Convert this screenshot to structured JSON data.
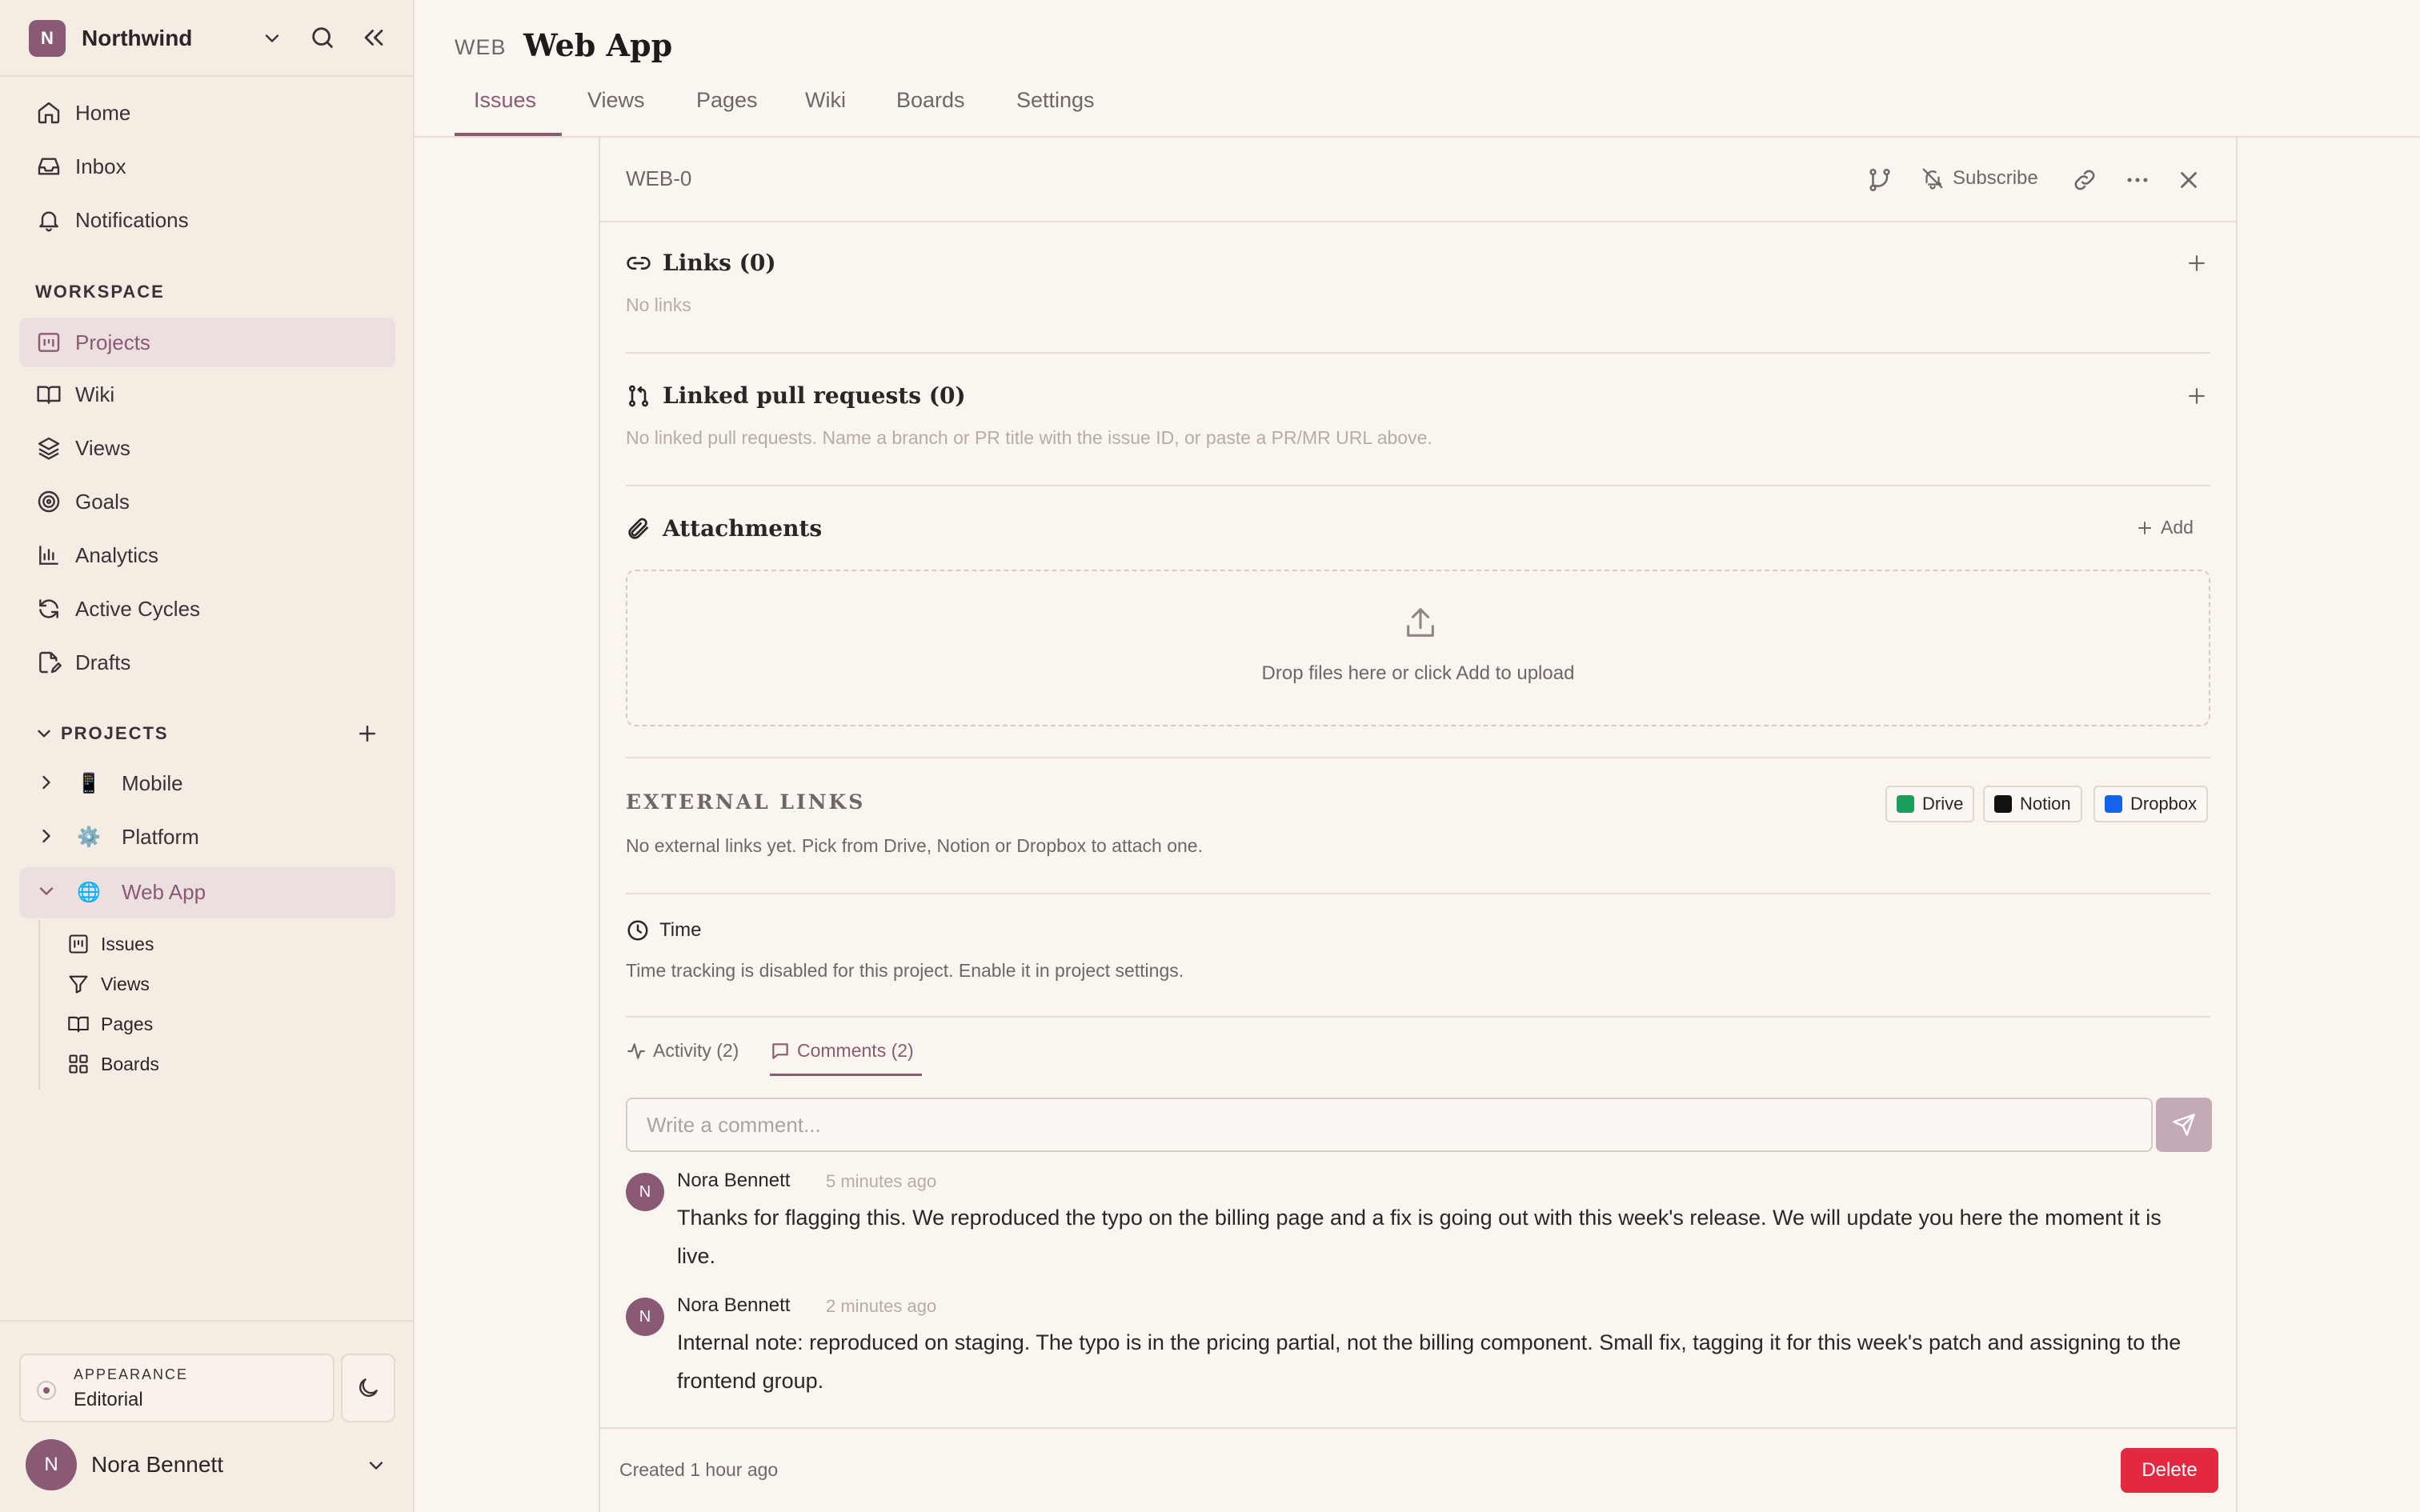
{
  "colors": {
    "accent": "#8a5a75",
    "background": "#faf6ef",
    "sidebar_bg": "#f4ede4",
    "active_bg": "#ebdfdf",
    "danger": "#e5283f"
  },
  "workspace": {
    "avatar_letter": "N",
    "name": "Northwind"
  },
  "nav": {
    "items": [
      {
        "label": "Home",
        "icon": "home-icon"
      },
      {
        "label": "Inbox",
        "icon": "inbox-icon"
      },
      {
        "label": "Notifications",
        "icon": "bell-icon"
      }
    ]
  },
  "workspace_section": {
    "title": "WORKSPACE",
    "items": [
      {
        "label": "Projects",
        "icon": "projects-icon",
        "active": true
      },
      {
        "label": "Wiki",
        "icon": "book-icon"
      },
      {
        "label": "Views",
        "icon": "layers-icon"
      },
      {
        "label": "Goals",
        "icon": "target-icon"
      },
      {
        "label": "Analytics",
        "icon": "bar-chart-icon"
      },
      {
        "label": "Active Cycles",
        "icon": "refresh-icon"
      },
      {
        "label": "Drafts",
        "icon": "draft-icon"
      }
    ]
  },
  "projects_section": {
    "title": "PROJECTS",
    "items": [
      {
        "label": "Mobile",
        "emoji": "📱",
        "expanded": false
      },
      {
        "label": "Platform",
        "emoji": "⚙️",
        "expanded": false
      },
      {
        "label": "Web App",
        "emoji": "🌐",
        "expanded": true,
        "active": true
      }
    ],
    "sub_items": [
      {
        "label": "Issues",
        "icon": "issues-icon"
      },
      {
        "label": "Views",
        "icon": "filter-icon"
      },
      {
        "label": "Pages",
        "icon": "book-icon"
      },
      {
        "label": "Boards",
        "icon": "grid-icon"
      }
    ]
  },
  "appearance": {
    "caption": "APPEARANCE",
    "value": "Editorial"
  },
  "user": {
    "avatar_letter": "N",
    "name": "Nora Bennett"
  },
  "header": {
    "project_key": "WEB",
    "project_title": "Web App",
    "tabs": [
      "Issues",
      "Views",
      "Pages",
      "Wiki",
      "Boards",
      "Settings"
    ],
    "active_tab": "Issues"
  },
  "issue": {
    "id": "WEB-0",
    "subscribe_label": "Subscribe",
    "links": {
      "title": "Links (0)",
      "empty": "No links"
    },
    "pull_requests": {
      "title": "Linked pull requests (0)",
      "empty": "No linked pull requests. Name a branch or PR title with the issue ID, or paste a PR/MR URL above."
    },
    "attachments": {
      "title": "Attachments",
      "add_label": "Add",
      "drop_text": "Drop files here or click Add to upload"
    },
    "external_links": {
      "title": "EXTERNAL LINKS",
      "empty": "No external links yet. Pick from Drive, Notion or Dropbox to attach one.",
      "providers": [
        {
          "label": "Drive",
          "color": "#1a9e5c"
        },
        {
          "label": "Notion",
          "color": "#111111"
        },
        {
          "label": "Dropbox",
          "color": "#1463e8"
        }
      ]
    },
    "time": {
      "title": "Time",
      "text": "Time tracking is disabled for this project. Enable it in project settings."
    },
    "activity_tabs": {
      "activity": "Activity (2)",
      "comments": "Comments (2)",
      "active": "comments"
    },
    "comment_input": {
      "placeholder": "Write a comment...",
      "value": ""
    },
    "comments": [
      {
        "avatar_letter": "N",
        "author": "Nora Bennett",
        "time": "5 minutes ago",
        "text": "Thanks for flagging this. We reproduced the typo on the billing page and a fix is going out with this week's release. We will update you here the moment it is live."
      },
      {
        "avatar_letter": "N",
        "author": "Nora Bennett",
        "time": "2 minutes ago",
        "text": "Internal note: reproduced on staging. The typo is in the pricing partial, not the billing component. Small fix, tagging it for this week's patch and assigning to the frontend group."
      }
    ],
    "footer": {
      "created": "Created 1 hour ago",
      "delete_label": "Delete"
    }
  }
}
